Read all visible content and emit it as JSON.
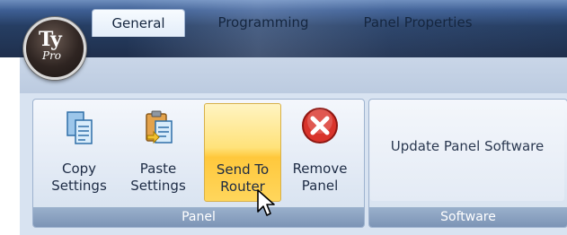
{
  "app": {
    "logo_text": "Ty",
    "logo_subtext": "Pro"
  },
  "tabs": [
    {
      "label": "General",
      "active": true
    },
    {
      "label": "Programming",
      "active": false
    },
    {
      "label": "Panel Properties",
      "active": false
    }
  ],
  "panel_group": {
    "label": "Panel",
    "buttons": [
      {
        "label": "Copy\nSettings",
        "icon": "copy-settings-icon"
      },
      {
        "label": "Paste\nSettings",
        "icon": "paste-settings-icon"
      },
      {
        "label": "Send To\nRouter",
        "icon": "",
        "state": "hover"
      },
      {
        "label": "Remove\nPanel",
        "icon": "remove-icon"
      }
    ]
  },
  "software_group": {
    "label": "Software",
    "buttons": [
      {
        "label": "Update Panel Software"
      }
    ]
  },
  "colors": {
    "hover_accent": "#ffc83c",
    "remove_red": "#d9342b",
    "titlebar": "#263e63"
  }
}
